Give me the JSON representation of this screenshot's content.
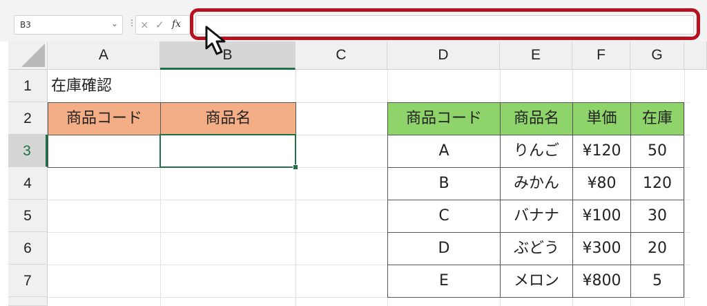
{
  "formula_bar": {
    "name_box": "B3",
    "fx": "fx",
    "cancel_icon": "×",
    "enter_icon": "✓",
    "formula": ""
  },
  "columns": [
    "A",
    "B",
    "C",
    "D",
    "E",
    "F",
    "G"
  ],
  "rows": [
    "1",
    "2",
    "3",
    "4",
    "5",
    "6",
    "7"
  ],
  "selected_cell": "B3",
  "sheet": {
    "title": "在庫確認",
    "lookup_headers": [
      "商品コード",
      "商品名"
    ],
    "table_headers": [
      "商品コード",
      "商品名",
      "単価",
      "在庫"
    ],
    "table_rows": [
      [
        "A",
        "りんご",
        "¥120",
        "50"
      ],
      [
        "B",
        "みかん",
        "¥80",
        "120"
      ],
      [
        "C",
        "バナナ",
        "¥100",
        "30"
      ],
      [
        "D",
        "ぶどう",
        "¥300",
        "20"
      ],
      [
        "E",
        "メロン",
        "¥800",
        "5"
      ]
    ]
  },
  "colors": {
    "orange_header": "#f4ae86",
    "green_header": "#8fd46b",
    "selection": "#1e7145",
    "highlight": "#b8111f"
  }
}
